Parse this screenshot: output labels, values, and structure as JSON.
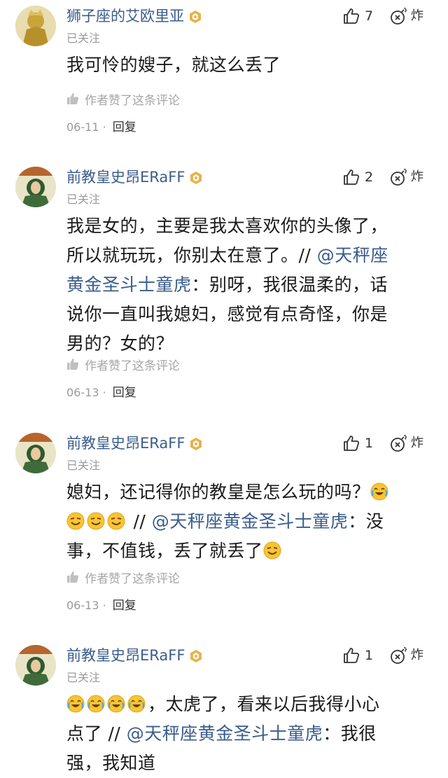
{
  "comments": [
    {
      "username": "狮子座的艾欧里亚",
      "follow_status": "已关注",
      "likes": "7",
      "bomb_label": "炸",
      "lines": [
        [
          {
            "t": "text",
            "v": "我可怜的嫂子，就这么丢了"
          }
        ]
      ],
      "author_liked": "作者赞了这条评论",
      "date": "06-11",
      "sep": "·",
      "reply_label": "回复",
      "avatar_color": "#c9a43a"
    },
    {
      "username": "前教皇史昂ERaFF",
      "follow_status": "已关注",
      "likes": "2",
      "bomb_label": "炸",
      "lines": [
        [
          {
            "t": "text",
            "v": "我是女的，主要是我太喜欢你的头像了，"
          }
        ],
        [
          {
            "t": "text",
            "v": "所以就玩玩，你别太在意了。// "
          },
          {
            "t": "mention",
            "v": "@天秤座"
          }
        ],
        [
          {
            "t": "mention",
            "v": "黄金圣斗士童虎"
          },
          {
            "t": "text",
            "v": "：别呀，我很温柔的，话"
          }
        ],
        [
          {
            "t": "text",
            "v": "说你一直叫我媳妇，感觉有点奇怪，你是"
          }
        ],
        [
          {
            "t": "text",
            "v": "男的？女的？"
          }
        ]
      ],
      "author_liked": "作者赞了这条评论",
      "date": "06-13",
      "sep": "·",
      "reply_label": "回复",
      "avatar_color": "#3f6b3a"
    },
    {
      "username": "前教皇史昂ERaFF",
      "follow_status": "已关注",
      "likes": "1",
      "bomb_label": "炸",
      "lines": [
        [
          {
            "t": "text",
            "v": "媳妇，还记得你的教皇是怎么玩的吗？"
          },
          {
            "t": "emoji",
            "v": "cry-laugh-emoji"
          }
        ],
        [
          {
            "t": "emoji",
            "v": "smug-emoji"
          },
          {
            "t": "emoji",
            "v": "smug-emoji"
          },
          {
            "t": "emoji",
            "v": "smug-emoji"
          },
          {
            "t": "text",
            "v": " // "
          },
          {
            "t": "mention",
            "v": "@天秤座黄金圣斗士童虎"
          },
          {
            "t": "text",
            "v": "：没"
          }
        ],
        [
          {
            "t": "text",
            "v": "事，不值钱，丢了就丢了"
          },
          {
            "t": "emoji",
            "v": "smug-emoji"
          }
        ]
      ],
      "author_liked": "作者赞了这条评论",
      "date": "06-13",
      "sep": "·",
      "reply_label": "回复",
      "avatar_color": "#3f6b3a"
    },
    {
      "username": "前教皇史昂ERaFF",
      "follow_status": "已关注",
      "likes": "1",
      "bomb_label": "炸",
      "lines": [
        [
          {
            "t": "emoji",
            "v": "cry-laugh-emoji"
          },
          {
            "t": "emoji",
            "v": "cry-laugh-emoji"
          },
          {
            "t": "emoji",
            "v": "cry-laugh-emoji"
          },
          {
            "t": "emoji",
            "v": "cry-laugh-emoji"
          },
          {
            "t": "text",
            "v": "，太虎了，看来以后我得小心"
          }
        ],
        [
          {
            "t": "text",
            "v": "点了 // "
          },
          {
            "t": "mention",
            "v": "@天秤座黄金圣斗士童虎"
          },
          {
            "t": "text",
            "v": "：我很"
          }
        ],
        [
          {
            "t": "text",
            "v": "强，我知道"
          }
        ]
      ],
      "avatar_color": "#3f6b3a"
    }
  ],
  "colors": {
    "username": "#3a5c8c",
    "mention": "#3a5c8c",
    "muted": "#9a9a9a"
  }
}
